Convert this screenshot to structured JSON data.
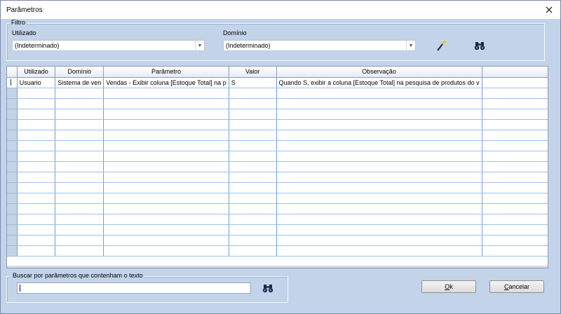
{
  "window": {
    "title": "Parâmetros"
  },
  "filter": {
    "legend": "Filtro",
    "utilizado_label": "Utilizado",
    "utilizado_value": "(Indeterminado)",
    "dominio_label": "Domínio",
    "dominio_value": "(Indeterminado)",
    "icons": [
      "magic-wand-icon",
      "binoculars-icon"
    ]
  },
  "grid": {
    "columns": [
      "Utilizado",
      "Domínio",
      "Parâmetro",
      "Valor",
      "Observação"
    ],
    "rows": [
      [
        "Usuario",
        "Sistema de ven",
        "Vendas - Exibir coluna [Estoque Total] na p",
        "S",
        "Quando S, exibir a coluna [Estoque Total] na pesquisa de produtos do v"
      ]
    ],
    "empty_row_count": 16
  },
  "search": {
    "legend": "Buscar por parâmetros que contenham o texto",
    "value": ""
  },
  "buttons": {
    "ok_label": "Ok",
    "ok_mnemonic": "O",
    "ok_rest": "k",
    "cancel_label": "Cancelar",
    "cancel_mnemonic": "C",
    "cancel_rest": "ancelar"
  },
  "colors": {
    "background": "#c3d3ea",
    "grid_line": "#6fa1d8"
  }
}
